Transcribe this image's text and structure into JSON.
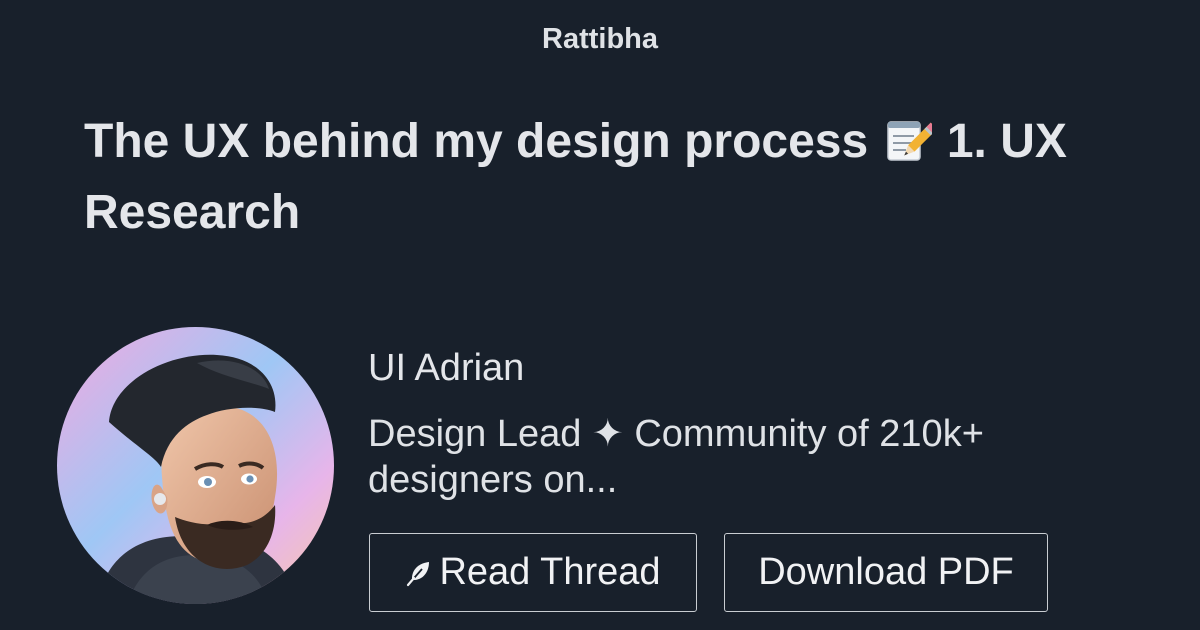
{
  "brand": "Rattibha",
  "thread": {
    "title_part1": "The UX behind my design process",
    "title_emoji_icon": "memo-pencil-icon",
    "title_part2": "1. UX Research"
  },
  "author": {
    "avatar_icon": "author-avatar",
    "name": "UI Adrian",
    "bio": "Design Lead ✦ Community of 210k+ designers on..."
  },
  "actions": {
    "read_icon": "feather-icon",
    "read_label": "Read Thread",
    "pdf_label": "Download PDF"
  },
  "colors": {
    "background": "#18202b",
    "text": "#e4e6ea",
    "button_border": "#c9cdd2"
  }
}
